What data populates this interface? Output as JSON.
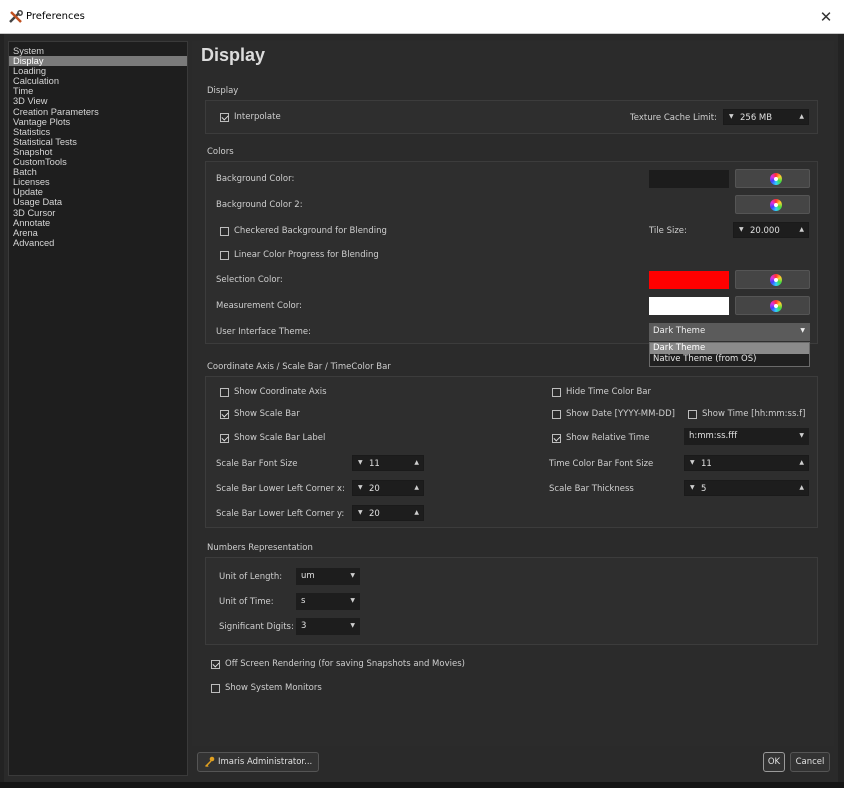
{
  "window": {
    "title": "Preferences",
    "close_glyph": "✕",
    "icon": "tools-icon"
  },
  "sidebar": {
    "items": [
      {
        "label": "System"
      },
      {
        "label": "Display"
      },
      {
        "label": "Loading"
      },
      {
        "label": "Calculation"
      },
      {
        "label": "Time"
      },
      {
        "label": "3D View"
      },
      {
        "label": "Creation Parameters"
      },
      {
        "label": "Vantage Plots"
      },
      {
        "label": "Statistics"
      },
      {
        "label": "Statistical Tests"
      },
      {
        "label": "Snapshot"
      },
      {
        "label": "CustomTools"
      },
      {
        "label": "Batch"
      },
      {
        "label": "Licenses"
      },
      {
        "label": "Update"
      },
      {
        "label": "Usage Data"
      },
      {
        "label": "3D Cursor"
      },
      {
        "label": "Annotate"
      },
      {
        "label": "Arena"
      },
      {
        "label": "Advanced"
      }
    ],
    "selected": "Display"
  },
  "page": {
    "title": "Display"
  },
  "display": {
    "section_title": "Display",
    "interpolate_label": "Interpolate",
    "interpolate_checked": true,
    "texture_cache_label": "Texture Cache Limit:",
    "texture_cache_value": "256 MB"
  },
  "colors": {
    "section_title": "Colors",
    "background_color_label": "Background Color:",
    "background_color_2_label": "Background Color 2:",
    "checkered_label": "Checkered Background for Blending",
    "checkered_checked": false,
    "tile_size_label": "Tile Size:",
    "tile_size_value": "20.000",
    "linear_progress_label": "Linear Color Progress for Blending",
    "linear_progress_checked": false,
    "selection_color_label": "Selection Color:",
    "measurement_color_label": "Measurement Color:",
    "theme_label": "User Interface Theme:",
    "theme_value": "Dark Theme",
    "theme_options": [
      "Dark Theme",
      "Native Theme (from OS)"
    ],
    "swatches": {
      "background": "#1c1c1c",
      "background2": "#2e2e2e",
      "selection": "#ff0000",
      "measurement": "#ffffff"
    }
  },
  "axis": {
    "section_title": "Coordinate Axis / Scale Bar / TimeColor Bar",
    "show_coordinate_axis": "Show Coordinate Axis",
    "show_coordinate_axis_checked": false,
    "show_scale_bar": "Show Scale Bar",
    "show_scale_bar_checked": true,
    "show_scale_bar_label": "Show Scale Bar Label",
    "show_scale_bar_label_checked": true,
    "hide_time_color_bar": "Hide Time Color Bar",
    "hide_time_color_bar_checked": false,
    "show_date": "Show Date [YYYY-MM-DD]",
    "show_date_checked": false,
    "show_time": "Show Time [hh:mm:ss.f]",
    "show_time_checked": false,
    "show_relative_time": "Show Relative Time",
    "show_relative_time_checked": true,
    "relative_time_format": "h:mm:ss.fff",
    "scale_bar_font_size_label": "Scale Bar Font Size",
    "scale_bar_font_size": "11",
    "lower_left_x_label": "Scale Bar Lower Left Corner x:",
    "lower_left_x": "20",
    "lower_left_y_label": "Scale Bar Lower Left Corner y:",
    "lower_left_y": "20",
    "time_color_bar_font_size_label": "Time Color Bar Font Size",
    "time_color_bar_font_size": "11",
    "scale_bar_thickness_label": "Scale Bar Thickness",
    "scale_bar_thickness": "5"
  },
  "numbers": {
    "section_title": "Numbers Representation",
    "unit_length_label": "Unit of Length:",
    "unit_length": "um",
    "unit_time_label": "Unit of Time:",
    "unit_time": "s",
    "sig_digits_label": "Significant Digits:",
    "sig_digits": "3"
  },
  "misc": {
    "offscreen_label": "Off Screen Rendering (for saving Snapshots and Movies)",
    "offscreen_checked": true,
    "system_monitors_label": "Show System Monitors",
    "system_monitors_checked": false
  },
  "footer": {
    "admin_label": "Imaris Administrator...",
    "ok_label": "OK",
    "cancel_label": "Cancel"
  }
}
